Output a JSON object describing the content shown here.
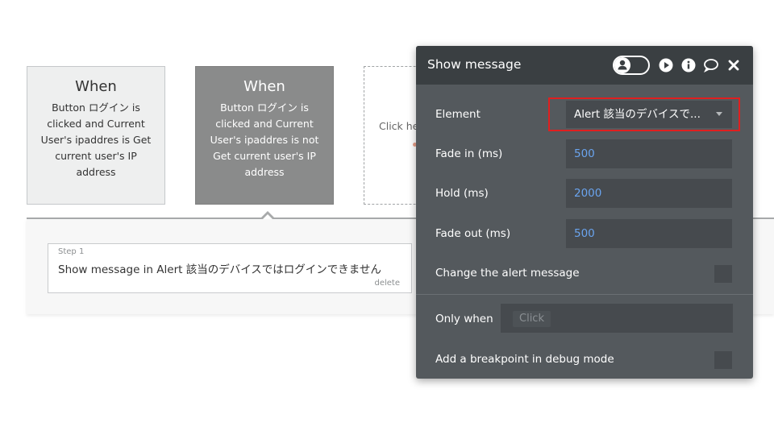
{
  "events": [
    {
      "when": "When",
      "description": "Button ログイン is clicked and Current User's ipaddres is Get current user's IP address"
    },
    {
      "when": "When",
      "description": "Button ログイン is clicked and Current User's ipaddres is not Get current user's IP address"
    },
    {
      "click_text": "Click he"
    }
  ],
  "step": {
    "label": "Step 1",
    "text": "Show message in Alert 該当のデバイスではログインできません",
    "delete": "delete"
  },
  "panel": {
    "title": "Show message",
    "toggle_icon": "user-icon",
    "header_icons": [
      "play-icon",
      "info-icon",
      "comment-icon",
      "close-icon"
    ],
    "fields": {
      "element": {
        "label": "Element",
        "value": "Alert 該当のデバイスで..."
      },
      "fade_in": {
        "label": "Fade in (ms)",
        "value": "500"
      },
      "hold": {
        "label": "Hold (ms)",
        "value": "2000"
      },
      "fade_out": {
        "label": "Fade out (ms)",
        "value": "500"
      },
      "change_alert": {
        "label": "Change the alert message"
      },
      "only_when": {
        "label": "Only when",
        "placeholder": "Click"
      },
      "breakpoint": {
        "label": "Add a breakpoint in debug mode"
      }
    },
    "colors": {
      "header": "#3a3f42",
      "body": "#54595d",
      "value": "#6aa4ef",
      "highlight": "#e01f1f"
    }
  }
}
